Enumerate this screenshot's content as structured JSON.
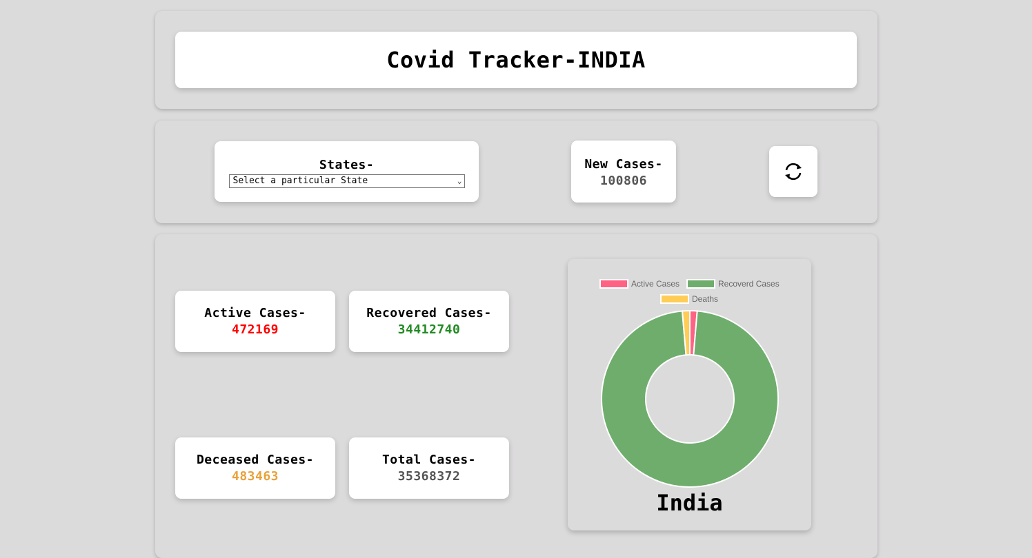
{
  "header": {
    "title": "Covid Tracker-INDIA"
  },
  "controls": {
    "states_label": "States-",
    "states_select_value": "Select a particular State",
    "new_cases_label": "New Cases-",
    "new_cases_value": "100806",
    "refresh_icon": "refresh-icon"
  },
  "stats": {
    "active": {
      "label": "Active Cases-",
      "value": "472169",
      "color": "#ff0000"
    },
    "recovered": {
      "label": "Recovered Cases-",
      "value": "34412740",
      "color": "#228b22"
    },
    "deceased": {
      "label": "Deceased Cases-",
      "value": "483463",
      "color": "#e8a23a"
    },
    "total": {
      "label": "Total Cases-",
      "value": "35368372",
      "color": "#555555"
    }
  },
  "chart_data": {
    "type": "pie",
    "title": "India",
    "legend_position": "top",
    "categories": [
      "Active Cases",
      "Recoverd Cases",
      "Deaths"
    ],
    "values": [
      472169,
      34412740,
      483463
    ],
    "colors": [
      "#ff6384",
      "#6fad6d",
      "#ffcd56"
    ]
  }
}
